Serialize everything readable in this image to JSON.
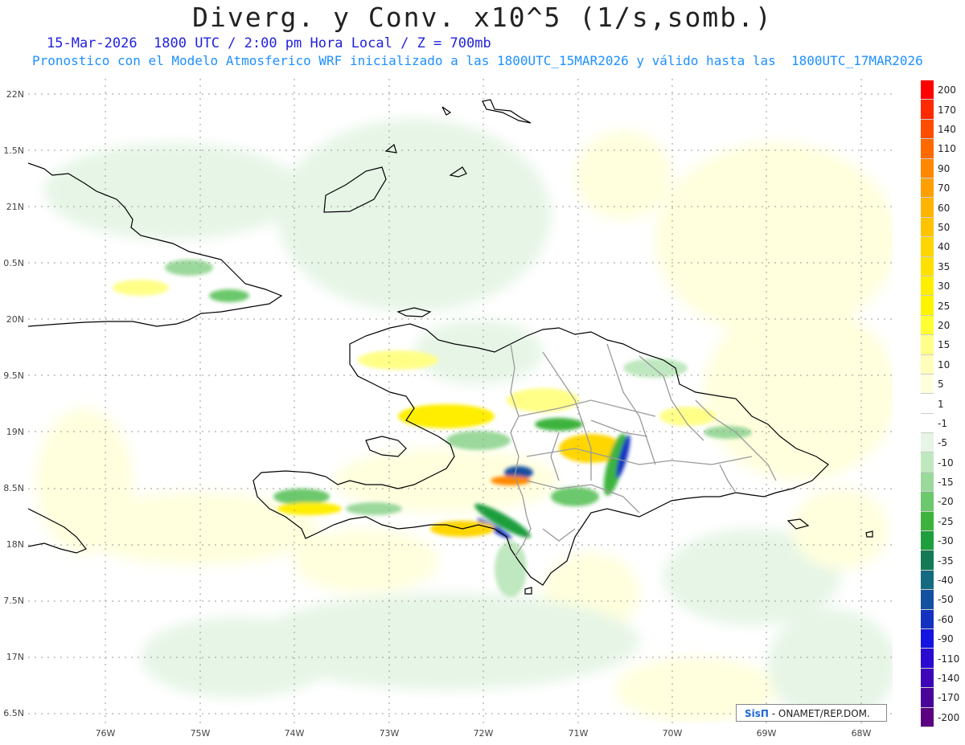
{
  "title": "Diverg. y Conv. x10^5 (1/s,somb.)",
  "subtitle1": "15-Mar-2026  1800 UTC / 2:00 pm Hora Local / Z = 700mb",
  "subtitle2": "Pronostico con el Modelo Atmosferico WRF inicializado a las 1800UTC_15MAR2026 y válido hasta las  1800UTC_17MAR2026",
  "credit": {
    "logo": "SisΠ",
    "text": " - ONAMET/REP.DOM."
  },
  "map": {
    "lat_labels": [
      "22N",
      "1.5N",
      "21N",
      "0.5N",
      "20N",
      "9.5N",
      "19N",
      "8.5N",
      "18N",
      "7.5N",
      "17N",
      "6.5N"
    ],
    "lon_labels": [
      "76W",
      "75W",
      "74W",
      "73W",
      "72W",
      "71W",
      "70W",
      "69W",
      "68W"
    ],
    "land_color": "#000000",
    "border_color": "#9a9a9a"
  },
  "colorbar": {
    "labels": [
      "200",
      "170",
      "140",
      "110",
      "90",
      "70",
      "60",
      "50",
      "40",
      "35",
      "30",
      "25",
      "20",
      "15",
      "10",
      "5",
      "1",
      "-1",
      "-5",
      "-10",
      "-15",
      "-20",
      "-25",
      "-30",
      "-35",
      "-40",
      "-50",
      "-60",
      "-90",
      "-110",
      "-140",
      "-170",
      "-200"
    ],
    "colors": [
      "#ff0000",
      "#ff2a00",
      "#ff4d00",
      "#ff6a00",
      "#ff8800",
      "#ffa000",
      "#ffb400",
      "#ffc400",
      "#ffd600",
      "#ffe000",
      "#ffee00",
      "#fff400",
      "#ffff33",
      "#ffff88",
      "#ffffbb",
      "#ffffdd",
      "#ffffff",
      "#ffffff",
      "#e6f5e6",
      "#c0e8c0",
      "#9bd89b",
      "#6cc86c",
      "#3db33d",
      "#1e9e3d",
      "#137a55",
      "#146a80",
      "#1450a0",
      "#1432c0",
      "#1414e0",
      "#2a0ad0",
      "#3c06b8",
      "#4a049a",
      "#5a0080"
    ]
  }
}
